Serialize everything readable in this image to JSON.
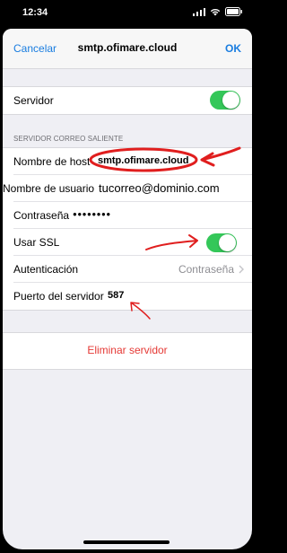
{
  "status_bar": {
    "time": "12:34"
  },
  "nav": {
    "cancel_label": "Cancelar",
    "title": "smtp.ofimare.cloud",
    "ok_label": "OK"
  },
  "server_toggle": {
    "label": "Servidor",
    "on": true
  },
  "section_header": "SERVIDOR CORREO SALIENTE",
  "fields": {
    "host": {
      "label": "Nombre de host",
      "value": "smtp.ofimare.cloud"
    },
    "username": {
      "label": "Nombre de usuario",
      "value": "tucorreo@dominio.com"
    },
    "password": {
      "label": "Contraseña",
      "value": "●●●●●●●●"
    },
    "ssl": {
      "label": "Usar SSL",
      "on": true
    },
    "auth": {
      "label": "Autenticación",
      "value": "Contraseña"
    },
    "port": {
      "label": "Puerto del servidor",
      "value": "587"
    }
  },
  "delete_label": "Eliminar servidor",
  "colors": {
    "accent": "#1a7de0",
    "toggle_on": "#34c759",
    "danger": "#e53935",
    "annotation": "#e01e1e"
  }
}
